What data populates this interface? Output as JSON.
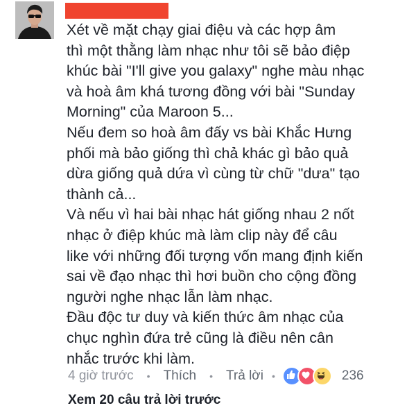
{
  "comment": {
    "author_name_redacted": true,
    "lines": [
      "Xét về mặt chạy giai điệu và các hợp âm",
      "thì một thằng làm nhạc như tôi sẽ bảo điệp",
      "khúc bài \"I'll give you galaxy\" nghe màu nhạc",
      "và hoà âm khá tương đồng với bài \"Sunday",
      "Morning\" của Maroon 5...",
      "Nếu đem so hoà âm đấy vs bài Khắc Hưng",
      "phối mà bảo giống thì chả khác gì bảo quả",
      "dừa giống quả dứa vì cùng từ chữ \"dưa\" tạo",
      "thành cả...",
      "Và nếu vì hai bài nhạc hát giống nhau 2 nốt",
      "nhạc ở điệp khúc mà làm clip này để câu",
      "like với những đối tượng vốn mang định kiến",
      "sai về đạo nhạc thì hơi buồn cho cộng đồng",
      "người nghe nhạc lẫn làm nhạc.",
      "Đầu độc tư duy và kiến thức âm nhạc của",
      "chục nghìn đứa trẻ cũng là điều nên cân",
      "nhắc trước khi làm."
    ]
  },
  "meta": {
    "timestamp": "4 giờ trước",
    "like_label": "Thích",
    "reply_label": "Trả lời",
    "separator": "•",
    "reaction_icons": [
      "like-icon",
      "love-icon",
      "haha-icon"
    ],
    "reaction_count": "236"
  },
  "view_more_label": "Xem 20 câu trả lời trước",
  "colors": {
    "redaction": "#f0442f",
    "like_blue": "#5890ff",
    "love_red": "#f25268",
    "haha_yellow": "#fcd669",
    "meta_gray": "#90949c"
  }
}
